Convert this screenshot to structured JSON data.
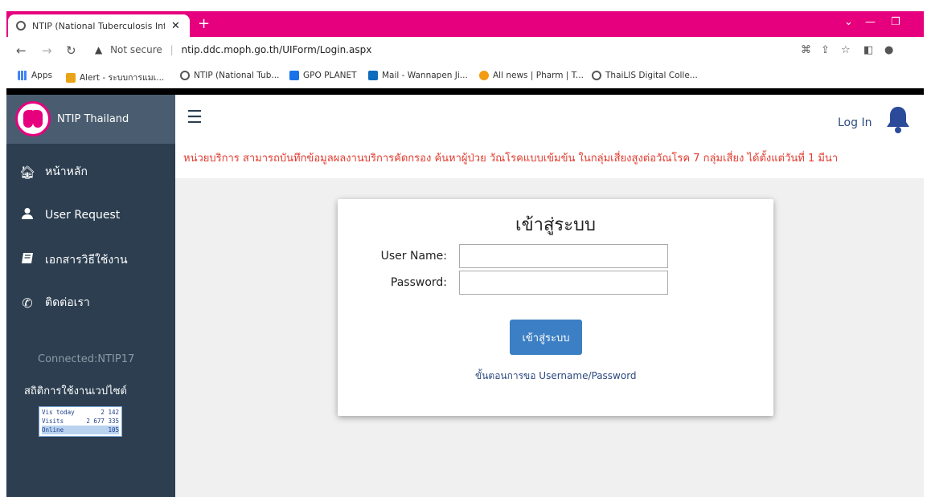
{
  "browser": {
    "tab_title": "NTIP (National Tuberculosis Infor",
    "tab_close": "✕",
    "new_tab": "+",
    "security_label": "Not secure",
    "url": "ntip.ddc.moph.go.th/UIForm/Login.aspx",
    "bookmarks": [
      {
        "label": "Apps",
        "color": "#4285f4"
      },
      {
        "label": "Alert - ระบบการแมเ...",
        "color": "#e8a317"
      },
      {
        "label": "NTIP (National Tub...",
        "color": "#555555"
      },
      {
        "label": "GPO PLANET",
        "color": "#1a73e8"
      },
      {
        "label": "Mail - Wannapen Ji...",
        "color": "#0f6cbd"
      },
      {
        "label": "All news | Pharm | T...",
        "color": "#f39c12"
      },
      {
        "label": "ThaiLIS Digital Colle...",
        "color": "#555555"
      }
    ]
  },
  "sidebar": {
    "brand": "NTIP Thailand",
    "items": [
      {
        "label": "หน้าหลัก",
        "icon": "home-icon"
      },
      {
        "label": "User Request",
        "icon": "user-icon"
      },
      {
        "label": "เอกสารวิธีใช้งาน",
        "icon": "book-icon"
      },
      {
        "label": "ติดต่อเรา",
        "icon": "phone-icon"
      }
    ],
    "connected": "Connected:NTIP17",
    "stats_title": "สถิติการใช้งานเวปไซต์",
    "counter": [
      {
        "label": "Vis today",
        "value": "2 142"
      },
      {
        "label": "Visits",
        "value": "2 677 335"
      },
      {
        "label": "Online",
        "value": "105"
      }
    ]
  },
  "header": {
    "login_link": "Log In",
    "marquee": "หน่วยบริการ สามารถบันทึกข้อมูลผลงานบริการคัดกรอง ค้นหาผู้ป่วย วัณโรคแบบเข้มข้น ในกลุ่มเสี่ยงสูงต่อวัณโรค 7 กลุ่มเสี่ยง ได้ตั้งแต่วันที่ 1 มีนา"
  },
  "login": {
    "title": "เข้าสู่ระบบ",
    "username_label": "User Name:",
    "username_value": "",
    "password_label": "Password:",
    "password_value": "",
    "submit_label": "เข้าสู่ระบบ",
    "help_link": "ขั้นตอนการขอ Username/Password"
  },
  "colors": {
    "tabbar": "#e6007e",
    "sidebar": "#2c3e50",
    "button": "#3c7fc4",
    "marquee_text": "#e23b2e"
  }
}
